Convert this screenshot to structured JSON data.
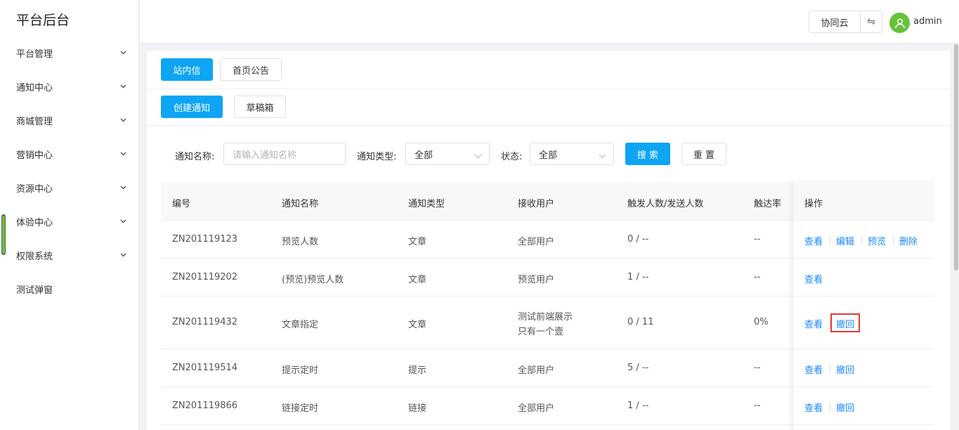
{
  "brand": "平台后台",
  "sidebar": {
    "items": [
      {
        "label": "平台管理",
        "expandable": true
      },
      {
        "label": "通知中心",
        "expandable": true
      },
      {
        "label": "商城管理",
        "expandable": true
      },
      {
        "label": "营销中心",
        "expandable": true
      },
      {
        "label": "资源中心",
        "expandable": true
      },
      {
        "label": "体验中心",
        "expandable": true
      },
      {
        "label": "权限系统",
        "expandable": true
      },
      {
        "label": "测试弹窗",
        "expandable": false
      }
    ]
  },
  "header": {
    "cloud_label": "协同云",
    "switch_icon": "⇋",
    "username": "admin",
    "avatar_color": "#67c23a"
  },
  "tabs": {
    "inbox": "站内信",
    "announcement": "首页公告"
  },
  "actions": {
    "create": "创建通知",
    "drafts": "草稿箱"
  },
  "filters": {
    "name_label": "通知名称:",
    "name_placeholder": "请输入通知名称",
    "type_label": "通知类型:",
    "type_value": "全部",
    "status_label": "状态:",
    "status_value": "全部",
    "search": "搜 索",
    "reset": "重 置"
  },
  "table": {
    "headers": {
      "id": "编号",
      "name": "通知名称",
      "type": "通知类型",
      "recipient": "接收用户",
      "counts": "触发人数/发送人数",
      "rate": "触达率",
      "ops": "操作"
    },
    "rows": [
      {
        "id": "ZN201119123",
        "name": "预览人数",
        "type": "文章",
        "recipient": "全部用户",
        "recipient2": "",
        "counts": "0 / --",
        "rate": "--",
        "ops": [
          "查看",
          "编辑",
          "预览",
          "删除"
        ]
      },
      {
        "id": "ZN201119202",
        "name": "(预览)预览人数",
        "type": "文章",
        "recipient": "预览用户",
        "recipient2": "",
        "counts": "1 / --",
        "rate": "--",
        "ops": [
          "查看"
        ]
      },
      {
        "id": "ZN201119432",
        "name": "文章指定",
        "type": "文章",
        "recipient": "测试前端展示",
        "recipient2": "只有一个壹",
        "counts": "0 / 11",
        "rate": "0%",
        "ops": [
          "查看",
          "撤回"
        ]
      },
      {
        "id": "ZN201119514",
        "name": "提示定时",
        "type": "提示",
        "recipient": "全部用户",
        "recipient2": "",
        "counts": "5 / --",
        "rate": "--",
        "ops": [
          "查看",
          "撤回"
        ]
      },
      {
        "id": "ZN201119866",
        "name": "链接定时",
        "type": "链接",
        "recipient": "全部用户",
        "recipient2": "",
        "counts": "1 / --",
        "rate": "--",
        "ops": [
          "查看",
          "撤回"
        ]
      }
    ]
  },
  "colors": {
    "primary": "#0ea5f5",
    "link": "#1989fa",
    "highlight": "#e53935"
  }
}
